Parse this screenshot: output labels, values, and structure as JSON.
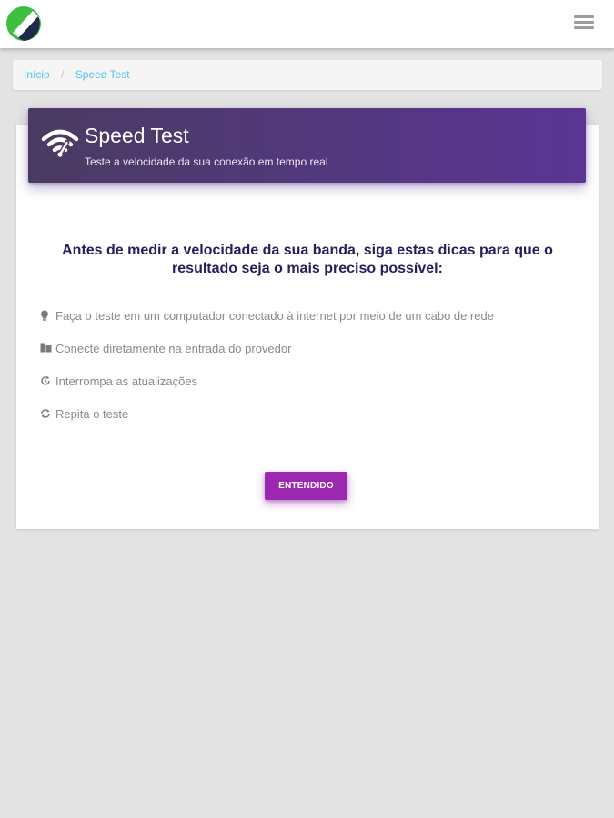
{
  "breadcrumb": {
    "home": "Início",
    "separator": "/",
    "current": "Speed Test"
  },
  "header": {
    "title": "Speed Test",
    "subtitle": "Teste a velocidade da sua conexão em tempo real",
    "icon": "wifi-icon"
  },
  "tips": {
    "heading": "Antes de medir a velocidade da sua banda, siga estas dicas para que o resultado seja o mais preciso possível:",
    "items": [
      {
        "icon": "lightbulb-icon",
        "label": "Faça o teste em um computador conectado à internet por meio de um cabo de rede"
      },
      {
        "icon": "router-icon",
        "label": "Conecte diretamente na entrada do provedor"
      },
      {
        "icon": "update-icon",
        "label": "Interrompa as atualizações"
      },
      {
        "icon": "repeat-icon",
        "label": "Repita o teste"
      }
    ]
  },
  "button": {
    "label": "ENTENDIDO"
  },
  "colors": {
    "header_gradient_start": "#4a3b62",
    "header_gradient_end": "#5a3594",
    "heading_text": "#2b1b5c",
    "button": "#9c27b0",
    "link": "#4fc3f7",
    "logo_green": "#3fbf3f",
    "logo_navy": "#1e2a4a"
  }
}
